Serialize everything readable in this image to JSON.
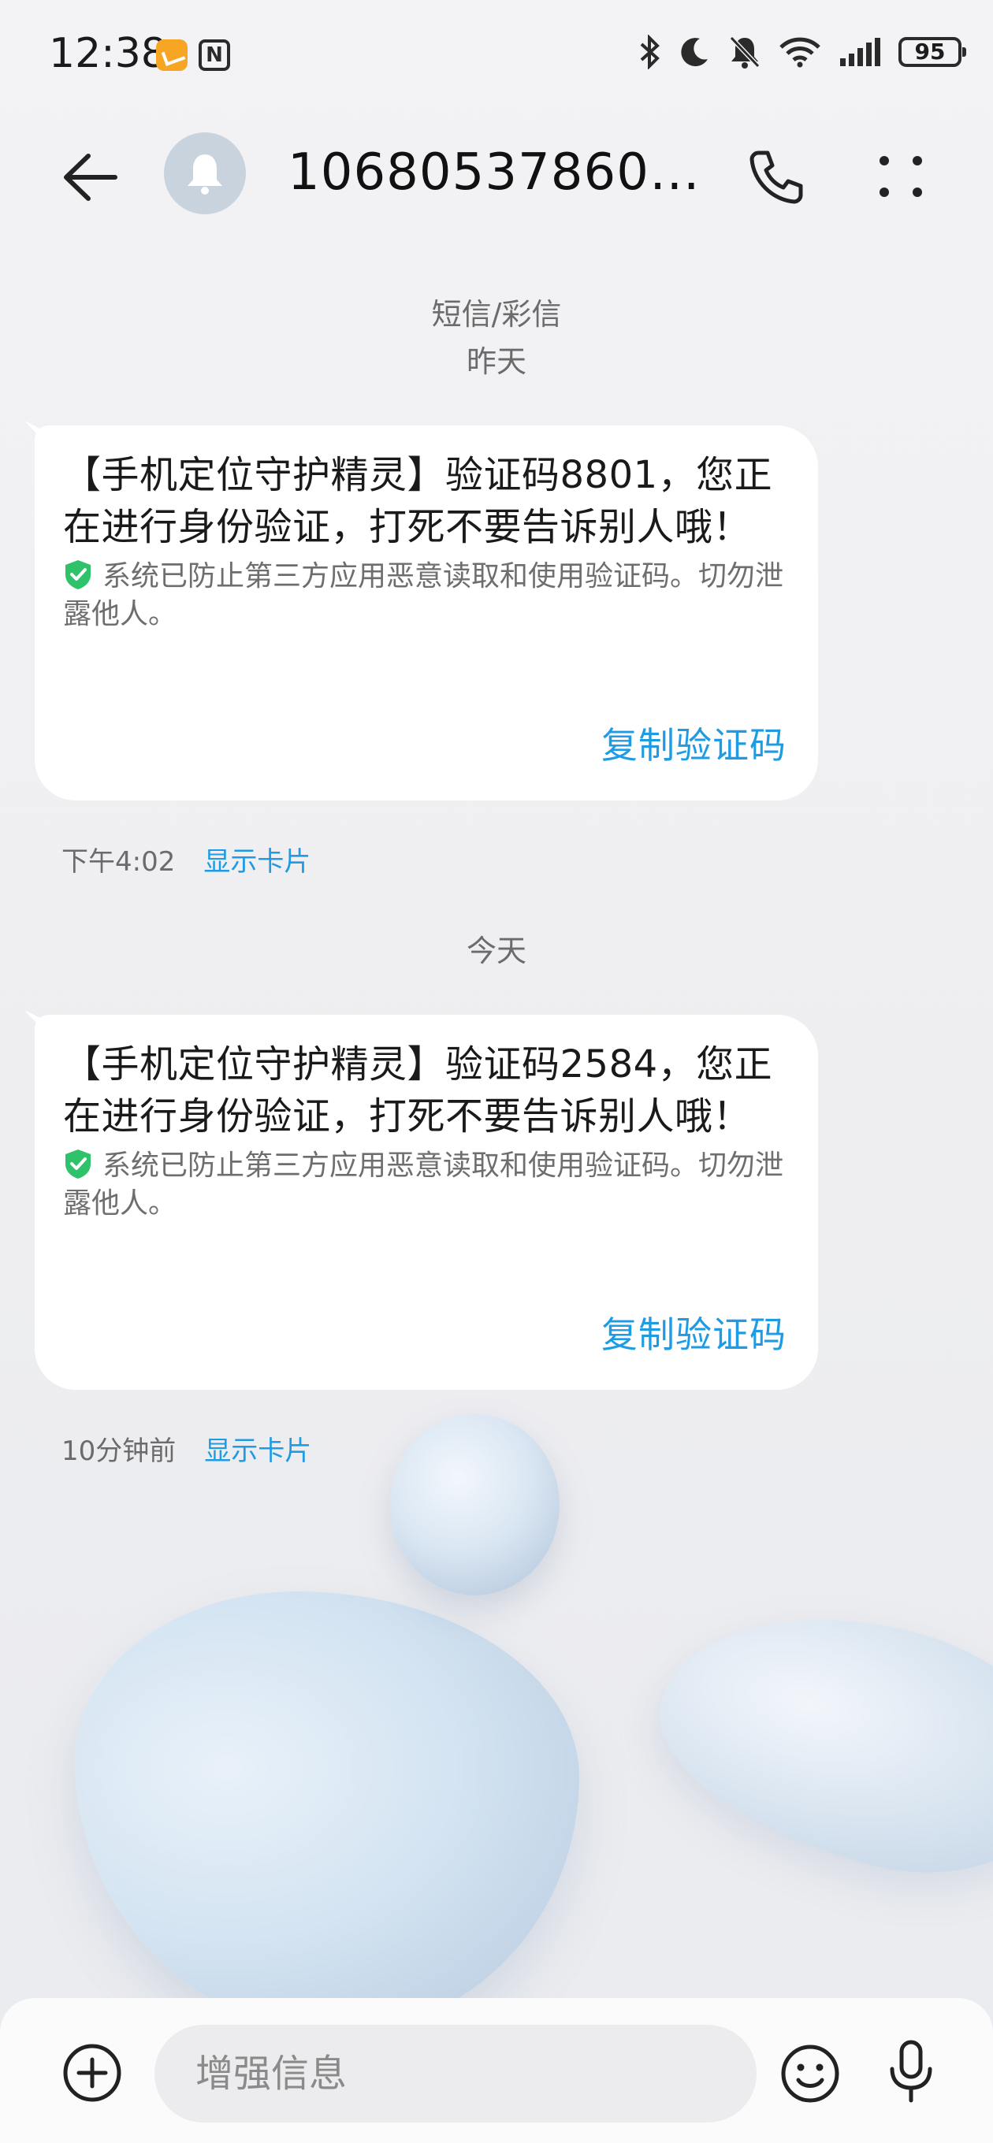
{
  "status_bar": {
    "time": "12:38",
    "battery": "95"
  },
  "header": {
    "title": "106805378601..."
  },
  "thread": {
    "category_label": "短信/彩信",
    "groups": [
      {
        "day_label": "昨天",
        "message": {
          "text": "【手机定位守护精灵】验证码8801，您正在进行身份验证，打死不要告诉别人哦！",
          "security_note": "系统已防止第三方应用恶意读取和使用验证码。切勿泄露他人。",
          "copy_label": "复制验证码",
          "time": "下午4:02",
          "show_card_label": "显示卡片"
        }
      },
      {
        "day_label": "今天",
        "message": {
          "text": "【手机定位守护精灵】验证码2584，您正在进行身份验证，打死不要告诉别人哦！",
          "security_note": "系统已防止第三方应用恶意读取和使用验证码。切勿泄露他人。",
          "copy_label": "复制验证码",
          "time": "10分钟前",
          "show_card_label": "显示卡片"
        }
      }
    ]
  },
  "input_bar": {
    "placeholder": "增强信息"
  },
  "icons": {
    "back": "arrow-left-icon",
    "avatar": "bell-icon",
    "call": "phone-icon",
    "more": "more-dots-icon",
    "shield": "shield-check-icon",
    "add": "plus-circle-icon",
    "emoji": "smiley-icon",
    "mic": "microphone-icon"
  },
  "colors": {
    "accent": "#1e9be3",
    "shield": "#2ec26a",
    "bubble": "#ffffff"
  }
}
